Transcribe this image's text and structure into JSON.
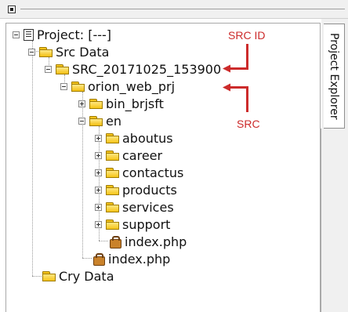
{
  "side_tab": {
    "label": "Project Explorer"
  },
  "tree": {
    "project": "Project: [---]",
    "src_data": "Src Data",
    "src_id_folder": "SRC_20171025_153900",
    "web_prj": "orion_web_prj",
    "bin": "bin_brjsft",
    "en": "en",
    "en_children": [
      "aboutus",
      "career",
      "contactus",
      "products",
      "services",
      "support"
    ],
    "en_index": "index.php",
    "root_index": "index.php",
    "cry_data": "Cry Data"
  },
  "annotations": {
    "src_id": "SRC ID",
    "src": "SRC",
    "color": "#cc2b2b"
  }
}
